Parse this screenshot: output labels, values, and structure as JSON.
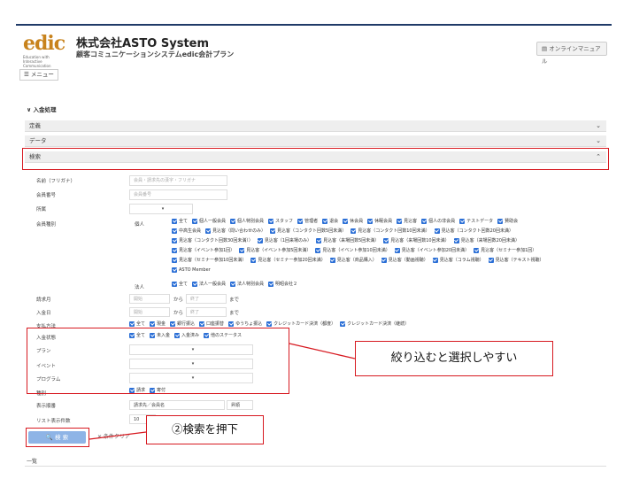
{
  "header": {
    "logo_text": "edic",
    "logo_sub": "Education with Interactive Communication",
    "company": "株式会社ASTO System",
    "product": "顧客コミュニケーションシステムedic会計プラン",
    "manual_label": "オンラインマニュアル",
    "menu_label": "メニュー"
  },
  "section": {
    "title": "∨ 入金処理",
    "bars": [
      "定義",
      "データ",
      "検索"
    ]
  },
  "form": {
    "name_label": "名前（フリガナ）",
    "name_placeholder": "会員・請求先の漢字・フリガナ",
    "member_no_label": "会員番号",
    "member_no_placeholder": "会員番号",
    "affiliation_label": "所属",
    "member_type_label": "会員種別",
    "individual_label": "個人",
    "individual_options": [
      [
        "全て",
        "個人一般会員",
        "個人特別会員",
        "スタッフ",
        "管理者",
        "退会",
        "休会員",
        "休眠会員",
        "見込客",
        "個人の非会員",
        "テストデータ",
        "賛助会"
      ],
      [
        "中高生会員",
        "見込客（問い合わせのみ）",
        "見込客（コンタクト回数5回未満）",
        "見込客（コンタクト回数10回未満）",
        "見込客（コンタクト回数20回未満）"
      ],
      [
        "見込客（コンタクト回数30回未満））",
        "見込客（1回来場のみ）",
        "見込客（来場回数5回未満）",
        "見込客（来場回数10回未満）",
        "見込客（来場回数20回未満）"
      ],
      [
        "見込客（イベント参加1回）",
        "見込客（イベント参加5回未満）",
        "見込客（イベント参加10回未満）",
        "見込客（イベント参加20回未満）",
        "見込客（セミナー参加1回）"
      ],
      [
        "見込客（セミナー参加10回未満）",
        "見込客（セミナー参加20回未満）",
        "見込客（商品購入）",
        "見込客（動画視聴）",
        "見込客（コラム視聴）",
        "見込客（テキスト視聴）"
      ],
      [
        "ASTO Member"
      ]
    ],
    "corporate_label": "法人",
    "corporate_options": [
      "全て",
      "法人一般会員",
      "法人特別会員",
      "明昭会社２"
    ],
    "billing_month_label": "請求月",
    "deposit_date_label": "入金日",
    "from_placeholder": "開始",
    "kara": "から",
    "to_placeholder": "終了",
    "made": "まで",
    "payment_label": "支払方法",
    "payment_options": [
      "全て",
      "現金",
      "銀行振込",
      "口座振替",
      "ゆうちょ振込",
      "クレジットカード決済（都度）",
      "クレジットカード決済（継続）"
    ],
    "status_label": "入金状態",
    "status_options": [
      "全て",
      "未入金",
      "入金済み",
      "他のステータス"
    ],
    "plan_label": "プラン",
    "event_label": "イベント",
    "program_label": "プログラム",
    "kind_label": "種別",
    "kind_options": [
      "請求",
      "寄付"
    ],
    "display_order_label": "表示順番",
    "display_order_value": "請求先／会員名",
    "display_order_dir": "昇順",
    "list_count_label": "リスト表示件数",
    "list_count_value": "10",
    "search_button": "検 索",
    "clear_button": "✕ 条件クリア"
  },
  "callouts": {
    "filter_note": "絞り込むと選択しやすい",
    "search_note": "②検索を押下"
  },
  "list_label": "一覧",
  "colors": {
    "accent_red": "#d71920",
    "checkbox_blue": "#2b6fd6",
    "search_button": "#8eb4e6",
    "logo_orange": "#c8831d",
    "top_line": "#1f3a68"
  }
}
